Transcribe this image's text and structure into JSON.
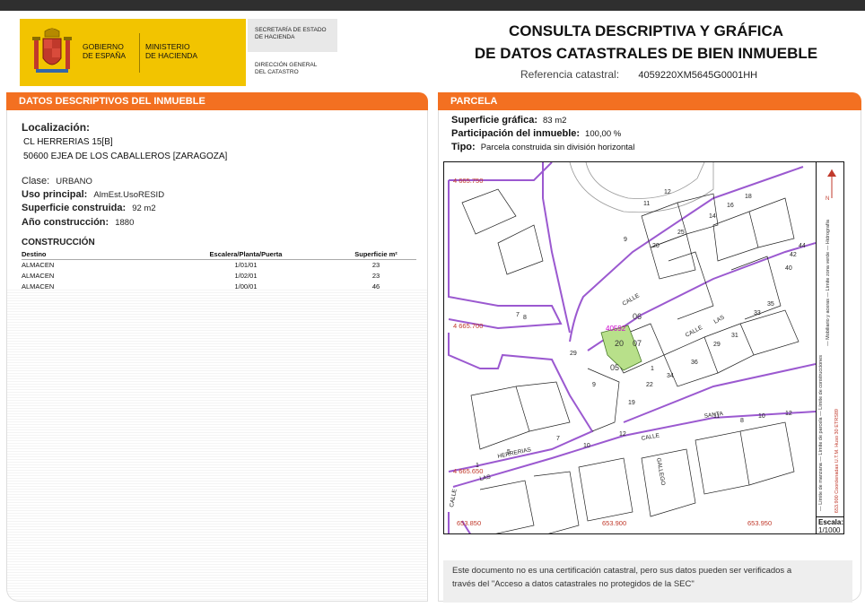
{
  "header": {
    "gov_line1": "GOBIERNO",
    "gov_line2": "DE ESPAÑA",
    "ministry_line1": "MINISTERIO",
    "ministry_line2": "DE HACIENDA",
    "secretary_line1": "SECRETARÍA DE ESTADO",
    "secretary_line2": "DE HACIENDA",
    "directorate_line1": "DIRECCIÓN GENERAL",
    "directorate_line2": "DEL CATASTRO",
    "title_line1": "CONSULTA DESCRIPTIVA Y GRÁFICA",
    "title_line2": "DE DATOS CATASTRALES DE BIEN INMUEBLE",
    "ref_label": "Referencia catastral:",
    "ref_value": "4059220XM5645G0001HH",
    "brand_color": "#f2c400",
    "accent_color": "#f37021"
  },
  "descriptive": {
    "section_title": "DATOS DESCRIPTIVOS DEL INMUEBLE",
    "location_label": "Localización:",
    "address_line1": "CL HERRERIAS 15[B]",
    "address_line2": "50600 EJEA DE LOS CABALLEROS [ZARAGOZA]",
    "class_label": "Clase:",
    "class_value": "URBANO",
    "use_label": "Uso principal:",
    "use_value": "AlmEst.UsoRESID",
    "area_label": "Superficie construida:",
    "area_value": "92 m2",
    "year_label": "Año construcción:",
    "year_value": "1880"
  },
  "construction": {
    "title": "CONSTRUCCIÓN",
    "headers": [
      "Destino",
      "Escalera/Planta/Puerta",
      "Superficie m²"
    ],
    "rows": [
      [
        "ALMACEN",
        "1/01/01",
        "23"
      ],
      [
        "ALMACEN",
        "1/02/01",
        "23"
      ],
      [
        "ALMACEN",
        "1/00/01",
        "46"
      ]
    ]
  },
  "parcel": {
    "section_title": "PARCELA",
    "graphic_area_label": "Superficie gráfica:",
    "graphic_area_value": "83 m2",
    "participation_label": "Participación del inmueble:",
    "participation_value": "100,00 %",
    "type_label": "Tipo:",
    "type_value": "Parcela construida sin división horizontal"
  },
  "map": {
    "coord_top_left": "4 665.750",
    "coord_mid_left": "4 665.700",
    "coord_low_left": "4 665.650",
    "coord_bottom_1": "653.850",
    "coord_bottom_2": "653.900",
    "coord_bottom_3": "653.950",
    "parcel_label_1": "20",
    "parcel_label_2": "07",
    "parcel_label_3": "06",
    "parcel_label_4": "05",
    "parcel_ref_label": "40592",
    "street_herrerias": "HERRERIAS",
    "street_las": "LAS",
    "street_calle_1": "CALLE",
    "street_calle_2": "CALLE",
    "street_calle_3": "CALLE",
    "street_santa": "SANTA",
    "street_gallego": "GALLEGO",
    "street_calle_v": "CALLE",
    "street_calle_las": "LAS",
    "legend_line1": "— Límite de manzana    — Límite de parcela    — Límite de construcciones",
    "legend_line2": "— Mobiliario y aceras    — Límite zona verde    — Hidrografía",
    "legend_coords": "653.900  Coordenadas U.T.M. Huso 30 ETRS89",
    "scale_label": "Escala:",
    "scale_value": "1/1000",
    "block_color": "#9b59d0",
    "highlight_color": "#b8e08a"
  },
  "footer": {
    "disclaimer_line1": "Este documento no es una certificación catastral, pero sus datos pueden ser verificados a",
    "disclaimer_line2": "través del \"Acceso a datos catastrales no protegidos de la SEC\""
  }
}
